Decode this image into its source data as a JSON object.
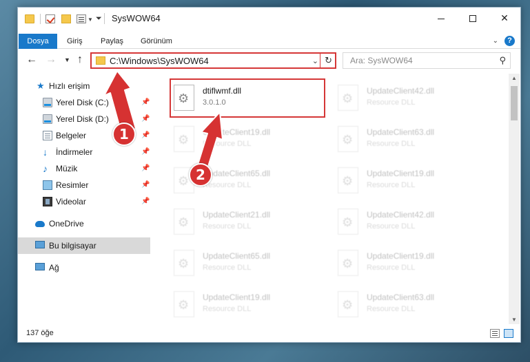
{
  "window": {
    "title": "SysWOW64",
    "controls": {
      "minimize": "—",
      "maximize": "□",
      "close": "✕"
    }
  },
  "ribbon": {
    "tabs": [
      {
        "label": "Dosya",
        "active": true
      },
      {
        "label": "Giriş"
      },
      {
        "label": "Paylaş"
      },
      {
        "label": "Görünüm"
      }
    ],
    "help": "?"
  },
  "nav": {
    "back": "←",
    "forward": "→",
    "recent": "⌄",
    "up": "↑",
    "address": "C:\\Windows\\SysWOW64",
    "search_placeholder": "Ara: SysWOW64"
  },
  "sidebar": {
    "items": [
      {
        "label": "Hızlı erişim",
        "icon": "star-icon"
      },
      {
        "label": "Yerel Disk (C:)",
        "icon": "disk-icon",
        "pinned": true
      },
      {
        "label": "Yerel Disk (D:)",
        "icon": "disk-icon",
        "pinned": true
      },
      {
        "label": "Belgeler",
        "icon": "documents-icon",
        "pinned": true
      },
      {
        "label": "İndirmeler",
        "icon": "download-icon",
        "pinned": true
      },
      {
        "label": "Müzik",
        "icon": "music-icon",
        "pinned": true
      },
      {
        "label": "Resimler",
        "icon": "pictures-icon",
        "pinned": true
      },
      {
        "label": "Videolar",
        "icon": "videos-icon",
        "pinned": true
      },
      {
        "label": "OneDrive",
        "icon": "cloud-icon"
      },
      {
        "label": "Bu bilgisayar",
        "icon": "computer-icon",
        "selected": true
      },
      {
        "label": "Ağ",
        "icon": "network-icon"
      }
    ]
  },
  "files": [
    {
      "name": "dtiflwmf.dll",
      "type": "3.0.1.0",
      "highlighted": true
    },
    {
      "name": "UpdateClient42.dll",
      "type": "Resource DLL"
    },
    {
      "name": "UpdateClient19.dll",
      "type": "Resource DLL"
    },
    {
      "name": "UpdateClient63.dll",
      "type": "Resource DLL"
    },
    {
      "name": "UpdateClient65.dll",
      "type": "Resource DLL"
    },
    {
      "name": "UpdateClient19.dll",
      "type": "Resource DLL"
    },
    {
      "name": "UpdateClient21.dll",
      "type": "Resource DLL"
    },
    {
      "name": "UpdateClient42.dll",
      "type": "Resource DLL"
    },
    {
      "name": "UpdateClient65.dll",
      "type": "Resource DLL"
    },
    {
      "name": "UpdateClient19.dll",
      "type": "Resource DLL"
    },
    {
      "name": "UpdateClient19.dll",
      "type": "Resource DLL"
    },
    {
      "name": "UpdateClient63.dll",
      "type": "Resource DLL"
    }
  ],
  "status": {
    "item_count": "137 öğe"
  },
  "callouts": [
    "1",
    "2"
  ],
  "colors": {
    "accent": "#1979ca",
    "highlight": "#d53636",
    "callout": "#d63232"
  }
}
